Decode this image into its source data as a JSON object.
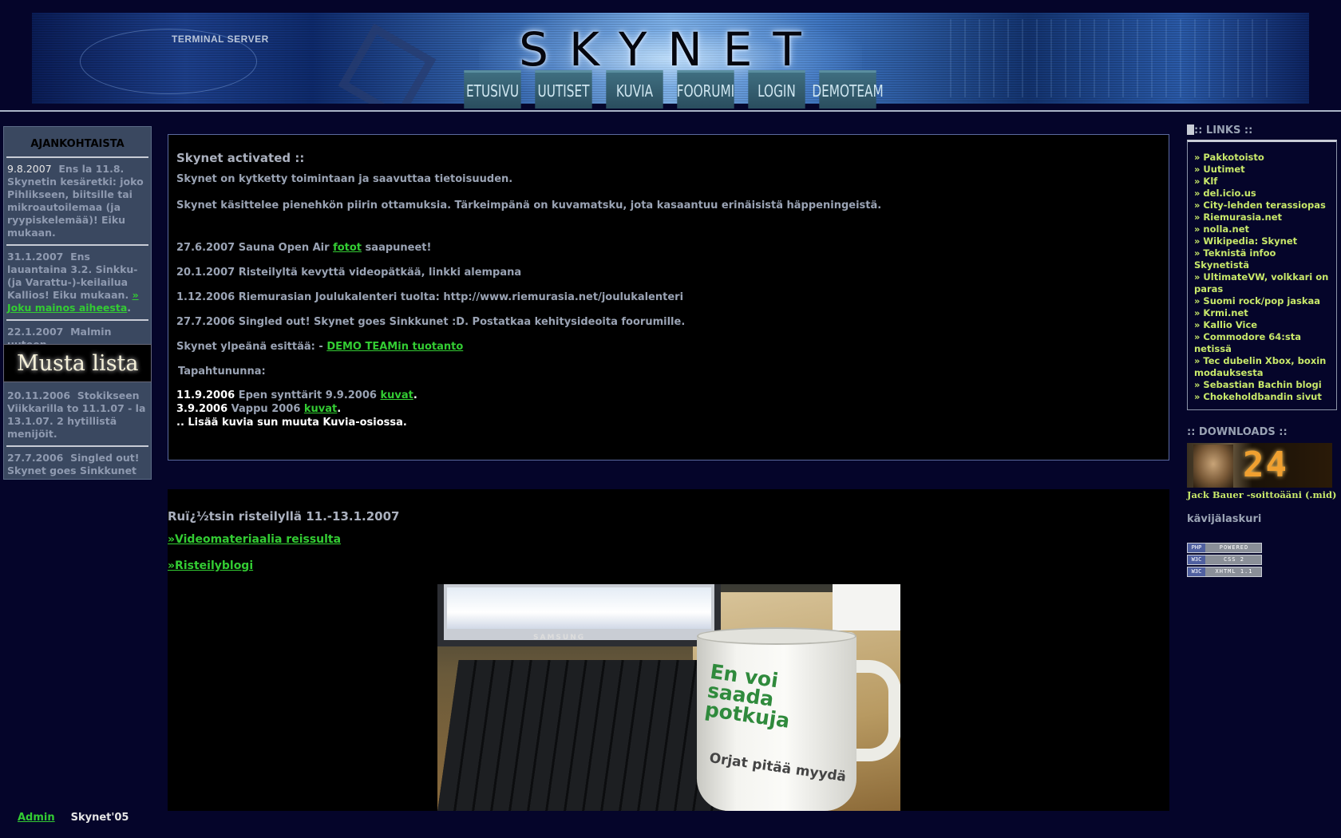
{
  "header": {
    "logo_text": "SKYNET",
    "terminal_label": "TERMINAL SERVER",
    "nav": [
      "ETUSIVU",
      "UUTISET",
      "KUVIA",
      "FOORUMI",
      "LOGIN",
      "DEMOTEAM"
    ]
  },
  "left_sidebar": {
    "title": "AJANKOHTAISTA",
    "items": [
      {
        "date": "9.8.2007",
        "text": "Ens la 11.8. Skynetin kesäretki: joko Pihlikseen, biitsille tai mikroautoilemaa (ja ryypiskelemää)! Eiku mukaan."
      },
      {
        "date": "31.1.2007",
        "text": "Ens lauantaina 3.2. Sinkku-(ja Varattu-)-keilailua Kallios! Eiku mukaan.",
        "link": "» Joku mainos aiheesta",
        "tail": "."
      },
      {
        "date": "22.1.2007",
        "text": "Malmin uuteen"
      },
      {
        "date": "20.11.2006",
        "text": "Stokikseen Viikkarilla to 11.1.07 - la 13.1.07. 2 hytillistä menijöit."
      },
      {
        "date": "27.7.2006",
        "text": "Singled out! Skynet goes Sinkkunet :D. Ideoita foorumille."
      }
    ],
    "overlay_label": "Musta lista"
  },
  "main": {
    "title": "Skynet activated ::",
    "intro1": "Skynet on kytketty toimintaan ja saavuttaa tietoisuuden.",
    "intro2": "Skynet käsittelee pienehkön piirin ottamuksia. Tärkeimpänä on kuvamatsku, jota kasaantuu erinäisistä häppeningeistä.",
    "news": [
      {
        "pre": "27.6.2007 Sauna Open Air ",
        "link": "fotot",
        "post": " saapuneet!"
      },
      {
        "pre": "20.1.2007 Risteilyltä kevyttä videopätkää, linkki alempana"
      },
      {
        "pre": "1.12.2006 Riemurasian Joulukalenteri tuolta: http://www.riemurasia.net/joulukalenteri"
      },
      {
        "pre": "27.7.2006 Singled out! Skynet goes Sinkkunet :D. Postatkaa kehitysideoita foorumille."
      }
    ],
    "demo_pre": "Skynet ylpeänä esittää: - ",
    "demo_link": "DEMO TEAMin tuotanto",
    "events_title": "Tapahtununna:",
    "events": [
      {
        "date": "11.9.2006",
        "text": " Epen synttärit 9.9.2006 ",
        "link": "kuvat",
        "tail": "."
      },
      {
        "date": "3.9.2006",
        "text": " Vappu 2006 ",
        "link": "kuvat",
        "tail": "."
      }
    ],
    "more": ".. Lisää kuvia sun muuta Kuvia-osiossa."
  },
  "second": {
    "title": "Ruï¿½tsin risteilyllä 11.-13.1.2007",
    "link1": "»Videomateriaalia reissulta",
    "link2": "»Risteilyblogi",
    "photo_brand": "SAMSUNG",
    "mug_text": "En voi saada potkuja",
    "mug_text2": "Orjat pitää myydä"
  },
  "right_sidebar": {
    "links_title": ":: LINKS ::",
    "links": [
      "» Pakkotoisto",
      "» Uutimet",
      "» Klf",
      "» del.icio.us",
      "» City-lehden terassiopas",
      "» Riemurasia.net",
      "» nolla.net",
      "» Wikipedia: Skynet",
      "» Teknistä infoo Skynetistä",
      "» UltimateVW, volkkari on paras",
      "» Suomi rock/pop jaskaa",
      "» Krmi.net",
      "» Kallio Vice",
      "» Commodore 64:sta netissä",
      "» Tec dubelin Xbox, boxin modauksesta",
      "» Sebastian Bachin blogi",
      "» Chokeholdbandin sivut"
    ],
    "downloads_title": ":: DOWNLOADS ::",
    "download_image_text": "24",
    "download_caption": "Jack Bauer -soittoääni (.mid)",
    "counter_label": "kävijälaskuri",
    "badges": [
      {
        "left": "PHP",
        "right": "POWERED"
      },
      {
        "left": "W3C",
        "right": "CSS 2"
      },
      {
        "left": "W3C",
        "right": "XHTML 1.1"
      }
    ]
  },
  "footer": {
    "admin": "Admin",
    "copyright": "Skynet'05"
  }
}
